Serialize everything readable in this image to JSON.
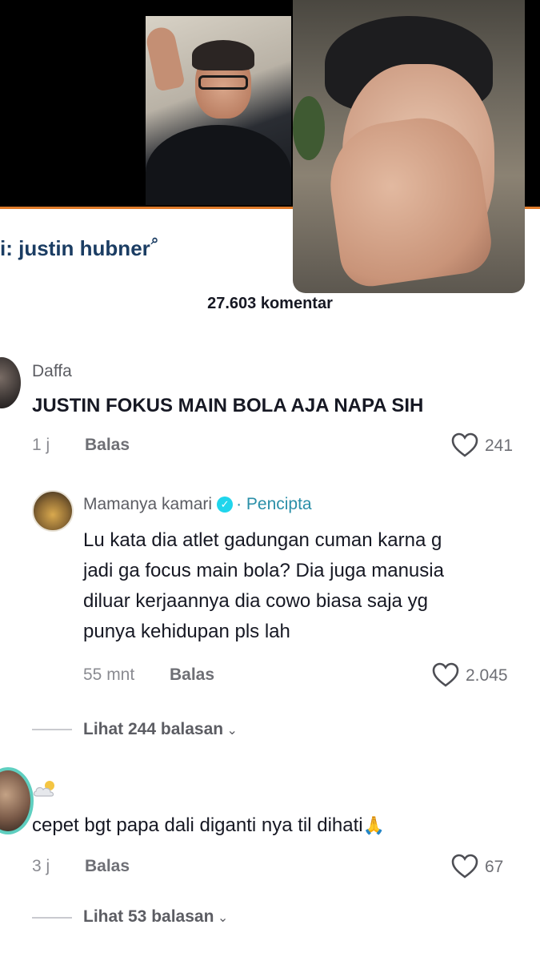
{
  "search_hint": {
    "prefix": "i: ",
    "query": "justin hubner",
    "icon": "search-icon"
  },
  "comment_count": "27.603 komentar",
  "comments": [
    {
      "username": "Daffa",
      "text": "JUSTIN FOKUS MAIN BOLA AJA NAPA SIH",
      "time": "1 j",
      "reply_label": "Balas",
      "likes": "241"
    },
    {
      "username": "Mamanya kamari",
      "badge": "· Pencipta",
      "text_lines": [
        "Lu kata dia atlet gadungan cuman karna g",
        "jadi ga focus main bola? Dia juga manusia",
        "diluar kerjaannya dia cowo biasa saja yg",
        "punya kehidupan pls lah"
      ],
      "time": "55 mnt",
      "reply_label": "Balas",
      "likes": "2.045"
    },
    {
      "username": "",
      "username_icon": "cloud-sun-icon",
      "text": "cepet bgt papa dali diganti nya til dihati",
      "emoji": "🙏",
      "time": "3 j",
      "reply_label": "Balas",
      "likes": "67"
    }
  ],
  "view_replies": [
    {
      "label": "Lihat 244 balasan"
    },
    {
      "label": "Lihat 53 balasan"
    }
  ],
  "colors": {
    "accent_orange": "#e07b2a",
    "verified": "#20d5ec",
    "creator": "#2a8fa8",
    "ring": "#5fcfc0"
  }
}
